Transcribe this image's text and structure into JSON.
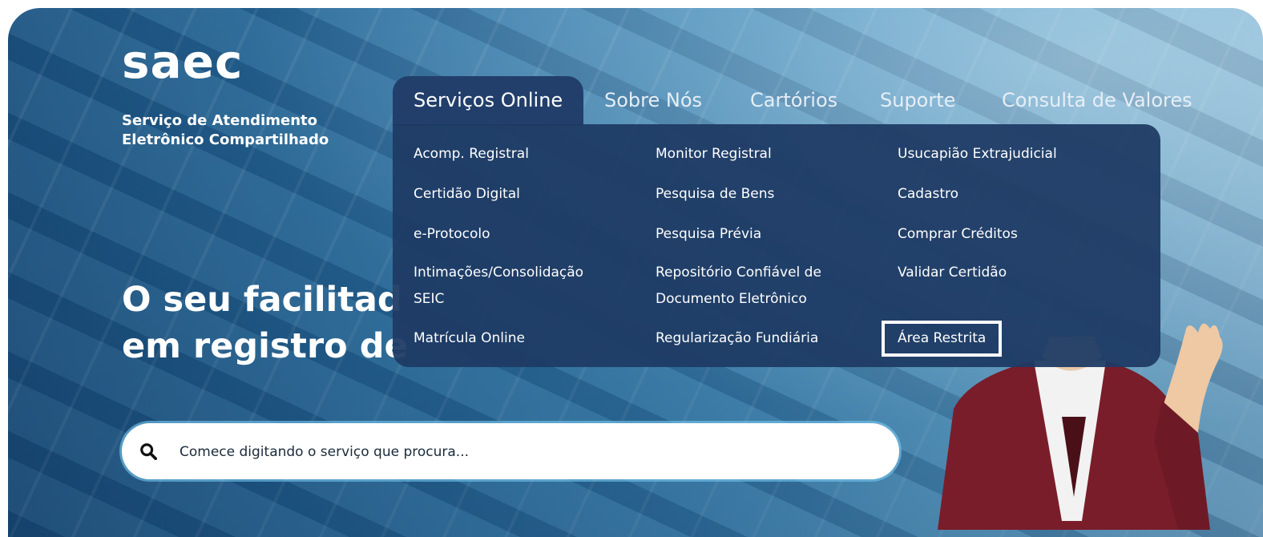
{
  "brand": {
    "logo": "saec",
    "tagline_line1": "Serviço de Atendimento",
    "tagline_line2": "Eletrônico Compartilhado"
  },
  "nav": [
    {
      "label": "Serviços Online",
      "active": true
    },
    {
      "label": "Sobre Nós",
      "active": false
    },
    {
      "label": "Cartórios",
      "active": false
    },
    {
      "label": "Suporte",
      "active": false
    },
    {
      "label": "Consulta de Valores",
      "active": false
    }
  ],
  "dropdown": {
    "col1": [
      "Acomp. Registral",
      "Certidão Digital",
      "e-Protocolo",
      "Intimações/Consolidação SEIC",
      "Matrícula Online"
    ],
    "col2": [
      "Monitor Registral",
      "Pesquisa de Bens",
      "Pesquisa Prévia",
      "Repositório Confiável de Documento Eletrônico",
      "Regularização Fundiária"
    ],
    "col3": [
      "Usucapião Extrajudicial",
      "Cadastro",
      "Comprar Créditos",
      "Validar Certidão",
      "Área Restrita"
    ],
    "highlighted": "Área Restrita"
  },
  "hero": {
    "line1": "O seu facilitad",
    "line2": "em registro de"
  },
  "search": {
    "placeholder": "Comece digitando o serviço que procura...",
    "icon": "search-icon"
  },
  "colors": {
    "dropdown_bg": "#1e3a64",
    "active_tab_bg": "#223f6b",
    "highlight_border": "#ffffff"
  }
}
